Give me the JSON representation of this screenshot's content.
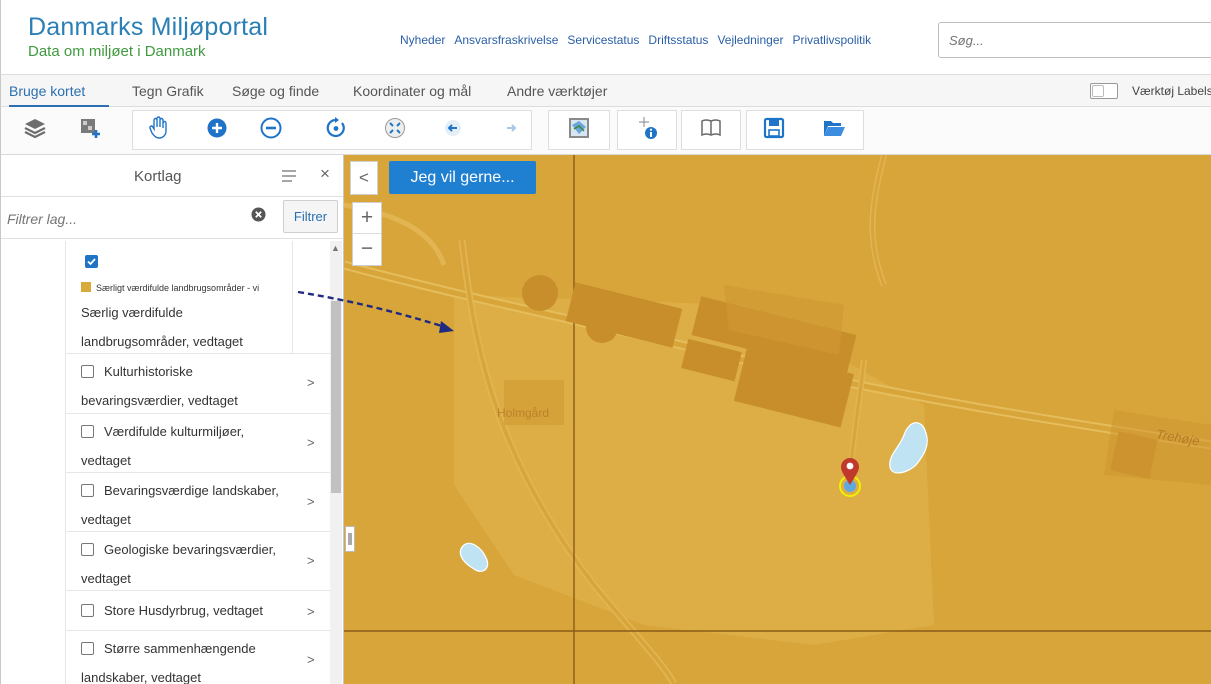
{
  "brand": {
    "title": "Danmarks Miljøportal",
    "subtitle": "Data om miljøet i Danmark"
  },
  "topnav": [
    "Nyheder",
    "Ansvarsfraskrivelse",
    "Servicestatus",
    "Driftsstatus",
    "Vejledninger",
    "Privatlivspolitik"
  ],
  "search": {
    "placeholder": "Søg..."
  },
  "tabs": [
    {
      "label": "Bruge kortet",
      "active": true
    },
    {
      "label": "Tegn Grafik"
    },
    {
      "label": "Søge og finde"
    },
    {
      "label": "Koordinater og mål"
    },
    {
      "label": "Andre værktøjer"
    }
  ],
  "tool_labels": {
    "label": "Værktøj Labels",
    "enabled": false
  },
  "toolbar_icons": [
    "layers-icon",
    "add-data-icon",
    "pan-hand-icon",
    "zoom-in-icon",
    "zoom-out-icon",
    "refresh-icon",
    "full-extent-icon",
    "back-icon",
    "forward-icon",
    "map-print-icon",
    "identify-icon",
    "book-icon",
    "save-icon",
    "open-folder-icon"
  ],
  "sidebar": {
    "title": "Kortlag",
    "filter_placeholder": "Filtrer lag...",
    "filter_button": "Filtrer",
    "legend_text": "Særligt værdifulde landbrugsområder - vi",
    "layers": [
      {
        "line1": "Særlig værdifulde",
        "line2": "landbrugsområder, vedtaget",
        "checked": true
      },
      {
        "line1": "Kulturhistoriske",
        "line2": "bevaringsværdier, vedtaget",
        "checked": false
      },
      {
        "line1": "Værdifulde kulturmiljøer,",
        "line2": "vedtaget",
        "checked": false
      },
      {
        "line1": "Bevaringsværdige landskaber,",
        "line2": "vedtaget",
        "checked": false
      },
      {
        "line1": "Geologiske bevaringsværdier,",
        "line2": "vedtaget",
        "checked": false
      },
      {
        "line1": "Store Husdyrbrug, vedtaget",
        "line2": "",
        "checked": false
      },
      {
        "line1": "Større sammenhængende",
        "line2": "landskaber, vedtaget",
        "checked": false
      }
    ]
  },
  "map": {
    "collapse": "<",
    "want_button": "Jeg vil gerne...",
    "zoom_in": "+",
    "zoom_out": "−",
    "place_label": "Holmgård",
    "road_label": "Trehøje",
    "colors": {
      "base": "#d7a53a",
      "area": "#dcae45",
      "building": "#c88e2c",
      "water": "#bfe3f3",
      "marker": "#c0392b",
      "arrow": "#1f2a80"
    }
  }
}
